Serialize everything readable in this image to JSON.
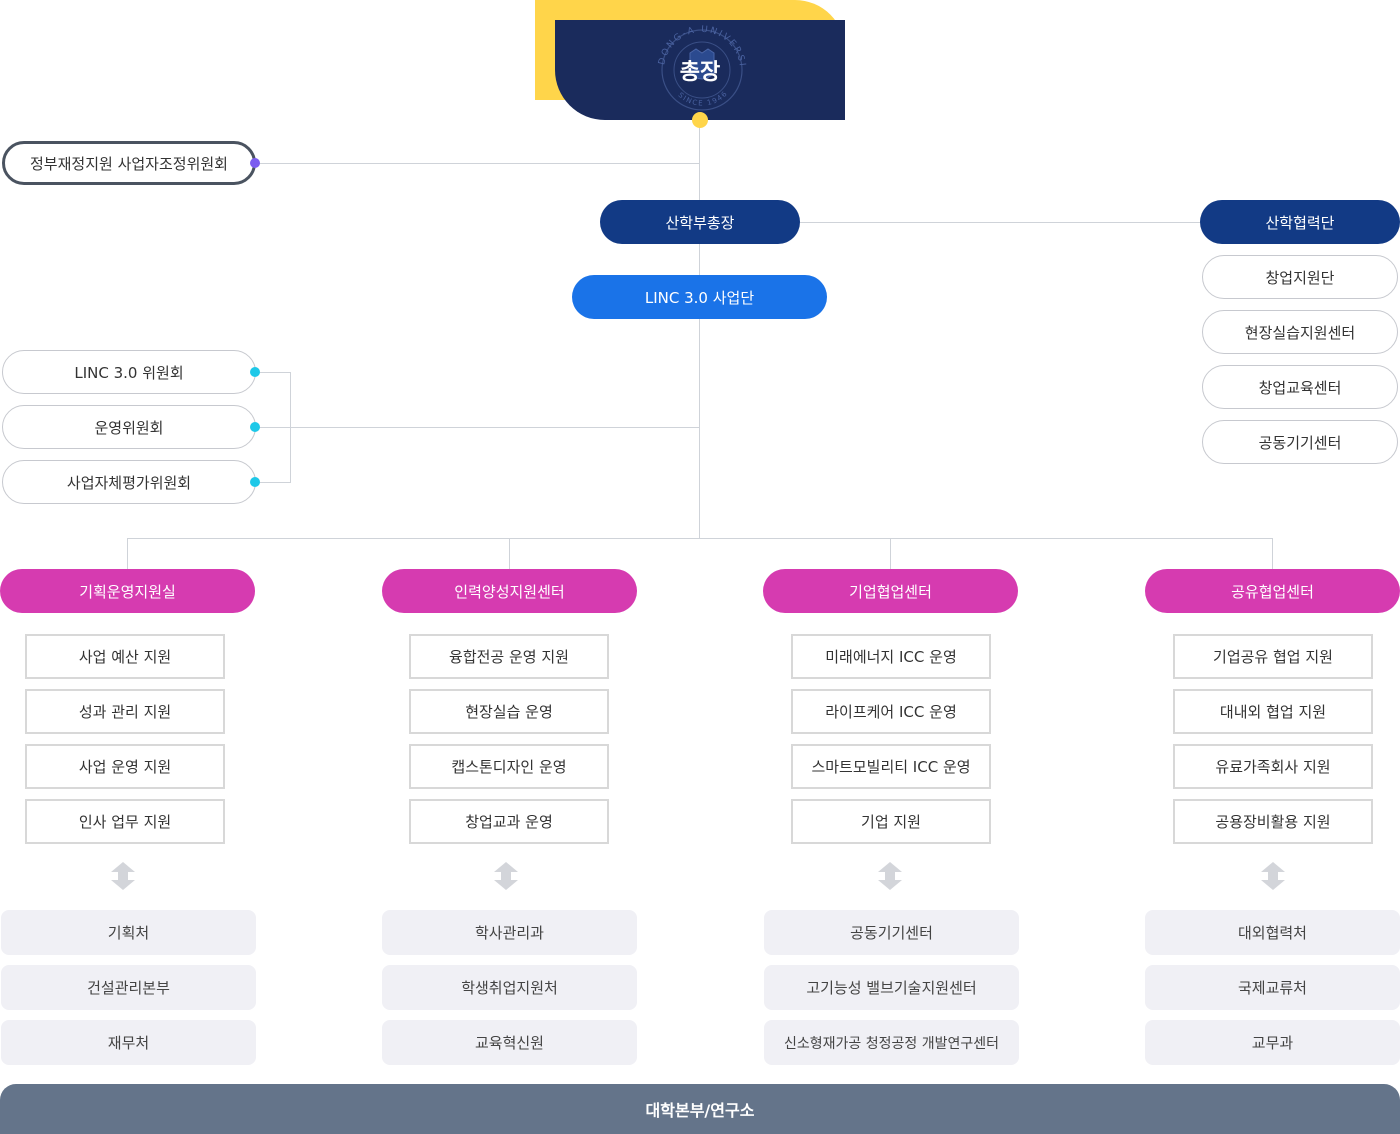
{
  "president": {
    "label": "총장",
    "seal_text": "DONG-A UNIVERSITY",
    "seal_year": "SINCE 1946"
  },
  "committee_top": "정부재정지원 사업자조정위원회",
  "vice_president": "산학부총장",
  "industry_group": {
    "title": "산학협력단",
    "items": [
      "창업지원단",
      "현장실습지원센터",
      "창업교육센터",
      "공동기기센터"
    ]
  },
  "linc": "LINC 3.0 사업단",
  "committees": [
    "LINC 3.0 위원회",
    "운영위원회",
    "사업자체평가위원회"
  ],
  "centers": [
    {
      "title": "기획운영지원실",
      "tasks": [
        "사업 예산 지원",
        "성과 관리 지원",
        "사업 운영 지원",
        "인사 업무 지원"
      ],
      "partners": [
        "기획처",
        "건설관리본부",
        "재무처"
      ]
    },
    {
      "title": "인력양성지원센터",
      "tasks": [
        "융합전공 운영 지원",
        "현장실습 운영",
        "캡스톤디자인 운영",
        "창업교과 운영"
      ],
      "partners": [
        "학사관리과",
        "학생취업지원처",
        "교육혁신원"
      ]
    },
    {
      "title": "기업협업센터",
      "tasks": [
        "미래에너지 ICC 운영",
        "라이프케어 ICC 운영",
        "스마트모빌리티 ICC 운영",
        "기업 지원"
      ],
      "partners": [
        "공동기기센터",
        "고기능성 밸브기술지원센터",
        "신소형재가공 청정공정 개발연구센터"
      ]
    },
    {
      "title": "공유협업센터",
      "tasks": [
        "기업공유 협업 지원",
        "대내외 협업 지원",
        "유료가족회사 지원",
        "공용장비활용 지원"
      ],
      "partners": [
        "대외협력처",
        "국제교류처",
        "교무과"
      ]
    }
  ],
  "footer": "대학본부/연구소",
  "colors": {
    "navy": "#1a2b5c",
    "yellow": "#ffd54a",
    "dark_blue": "#123a85",
    "blue": "#1a73e8",
    "magenta": "#d63bb0",
    "cyan_dot": "#1ec8e8",
    "purple_dot": "#7b5cf0",
    "footer_gray": "#64748a"
  }
}
